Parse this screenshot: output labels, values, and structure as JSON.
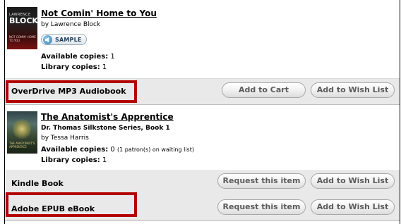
{
  "items": [
    {
      "title": "Not Comin' Home to You",
      "author": "by Lawrence Block",
      "sample_label": "SAMPLE",
      "available_label": "Available copies:",
      "available_value": "1",
      "library_label": "Library copies:",
      "library_value": "1",
      "cover_text": {
        "top": "LAWRENCE",
        "name": "BLOCK",
        "subtitle": "NOT COMIN' HOME TO YOU"
      }
    },
    {
      "title": "The Anatomist's Apprentice",
      "series": "Dr. Thomas Silkstone Series, Book 1",
      "author": "by Tessa Harris",
      "available_label": "Available copies:",
      "available_value": "0",
      "waiting_note": "(1 patron(s) on waiting list)",
      "library_label": "Library copies:",
      "library_value": "1",
      "cover_text": {
        "subtitle": "THE ANATOMIST'S APPRENTICE"
      }
    }
  ],
  "formats": [
    {
      "label": "OverDrive MP3 Audiobook",
      "primary_button": "Add to Cart",
      "wish_button": "Add to Wish List",
      "highlighted": true
    },
    {
      "label": "Kindle Book",
      "primary_button": "Request this item",
      "wish_button": "Add to Wish List",
      "highlighted": false
    },
    {
      "label": "Adobe EPUB eBook",
      "primary_button": "Request this item",
      "wish_button": "Add to Wish List",
      "highlighted": true
    }
  ],
  "colors": {
    "highlight": "#b30000",
    "band": "#e9e9e9",
    "button_text": "#5a5a5a"
  },
  "icons": {
    "sample": "speaker-icon"
  }
}
